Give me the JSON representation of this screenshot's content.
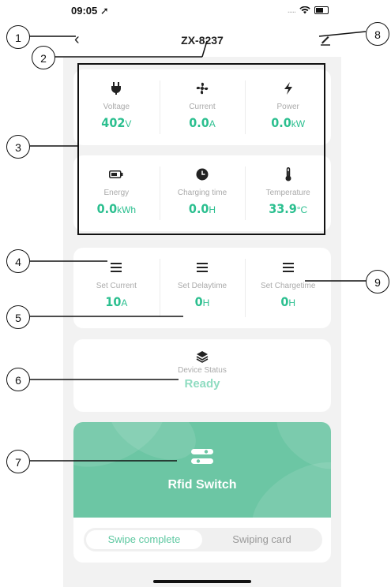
{
  "status_bar": {
    "time": "09:05",
    "signal": "....."
  },
  "nav": {
    "title": "ZX-8237"
  },
  "metrics": [
    {
      "label": "Voltage",
      "value": "402",
      "unit": "V",
      "icon": "plug-icon"
    },
    {
      "label": "Current",
      "value": "0.0",
      "unit": "A",
      "icon": "fan-icon"
    },
    {
      "label": "Power",
      "value": "0.0",
      "unit": "kW",
      "icon": "bolt-icon"
    },
    {
      "label": "Energy",
      "value": "0.0",
      "unit": "kWh",
      "icon": "battery-icon"
    },
    {
      "label": "Charging time",
      "value": "0.0",
      "unit": "H",
      "icon": "clock-icon"
    },
    {
      "label": "Temperature",
      "value": "33.9",
      "unit": "°C",
      "icon": "thermometer-icon"
    }
  ],
  "settings": [
    {
      "label": "Set Current",
      "value": "10",
      "unit": "A"
    },
    {
      "label": "Set Delaytime",
      "value": "0",
      "unit": "H"
    },
    {
      "label": "Set Chargetime",
      "value": "0",
      "unit": "H"
    }
  ],
  "device_status": {
    "label": "Device Status",
    "value": "Ready"
  },
  "rfid": {
    "label": "Rfid Switch"
  },
  "tabs": {
    "active": "Swipe complete",
    "inactive": "Swiping card"
  },
  "callouts": [
    "1",
    "2",
    "3",
    "4",
    "5",
    "6",
    "7",
    "8",
    "9"
  ],
  "colors": {
    "accent": "#2bbf8f",
    "rfid_bg": "#6cc6a4",
    "status_ready": "#8fdcc1"
  }
}
